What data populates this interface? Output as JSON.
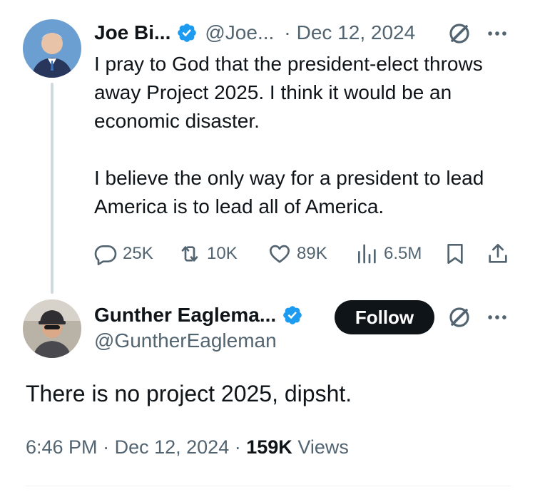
{
  "parent_tweet": {
    "author_name": "Joe Bi...",
    "author_handle": "@Joe...",
    "separator": "·",
    "date": "Dec 12, 2024",
    "text_paragraph_1": "I pray to God that the president-elect throws away Project 2025. I think it would be an economic disaster.",
    "text_paragraph_2": "I believe the only way for a president to lead America is to lead all of America.",
    "stats": {
      "replies": "25K",
      "reposts": "10K",
      "likes": "89K",
      "views": "6.5M"
    }
  },
  "reply_tweet": {
    "author_name": "Gunther Eaglema...",
    "author_handle": "@GuntherEagleman",
    "follow_label": "Follow",
    "text": "There is no project 2025, dipsht.",
    "time": "6:46 PM",
    "separator_1": "·",
    "date": "Dec 12, 2024",
    "separator_2": "·",
    "views_count": "159K",
    "views_label": "Views"
  },
  "colors": {
    "text_primary": "#0f1419",
    "text_secondary": "#536471",
    "verified_blue": "#1d9bf0",
    "thread_line": "#cfd9de",
    "follow_bg": "#0f1419"
  },
  "icons": [
    "verified-badge-icon",
    "grok-icon",
    "more-icon",
    "reply-icon",
    "repost-icon",
    "like-icon",
    "views-icon",
    "bookmark-icon",
    "share-icon"
  ]
}
